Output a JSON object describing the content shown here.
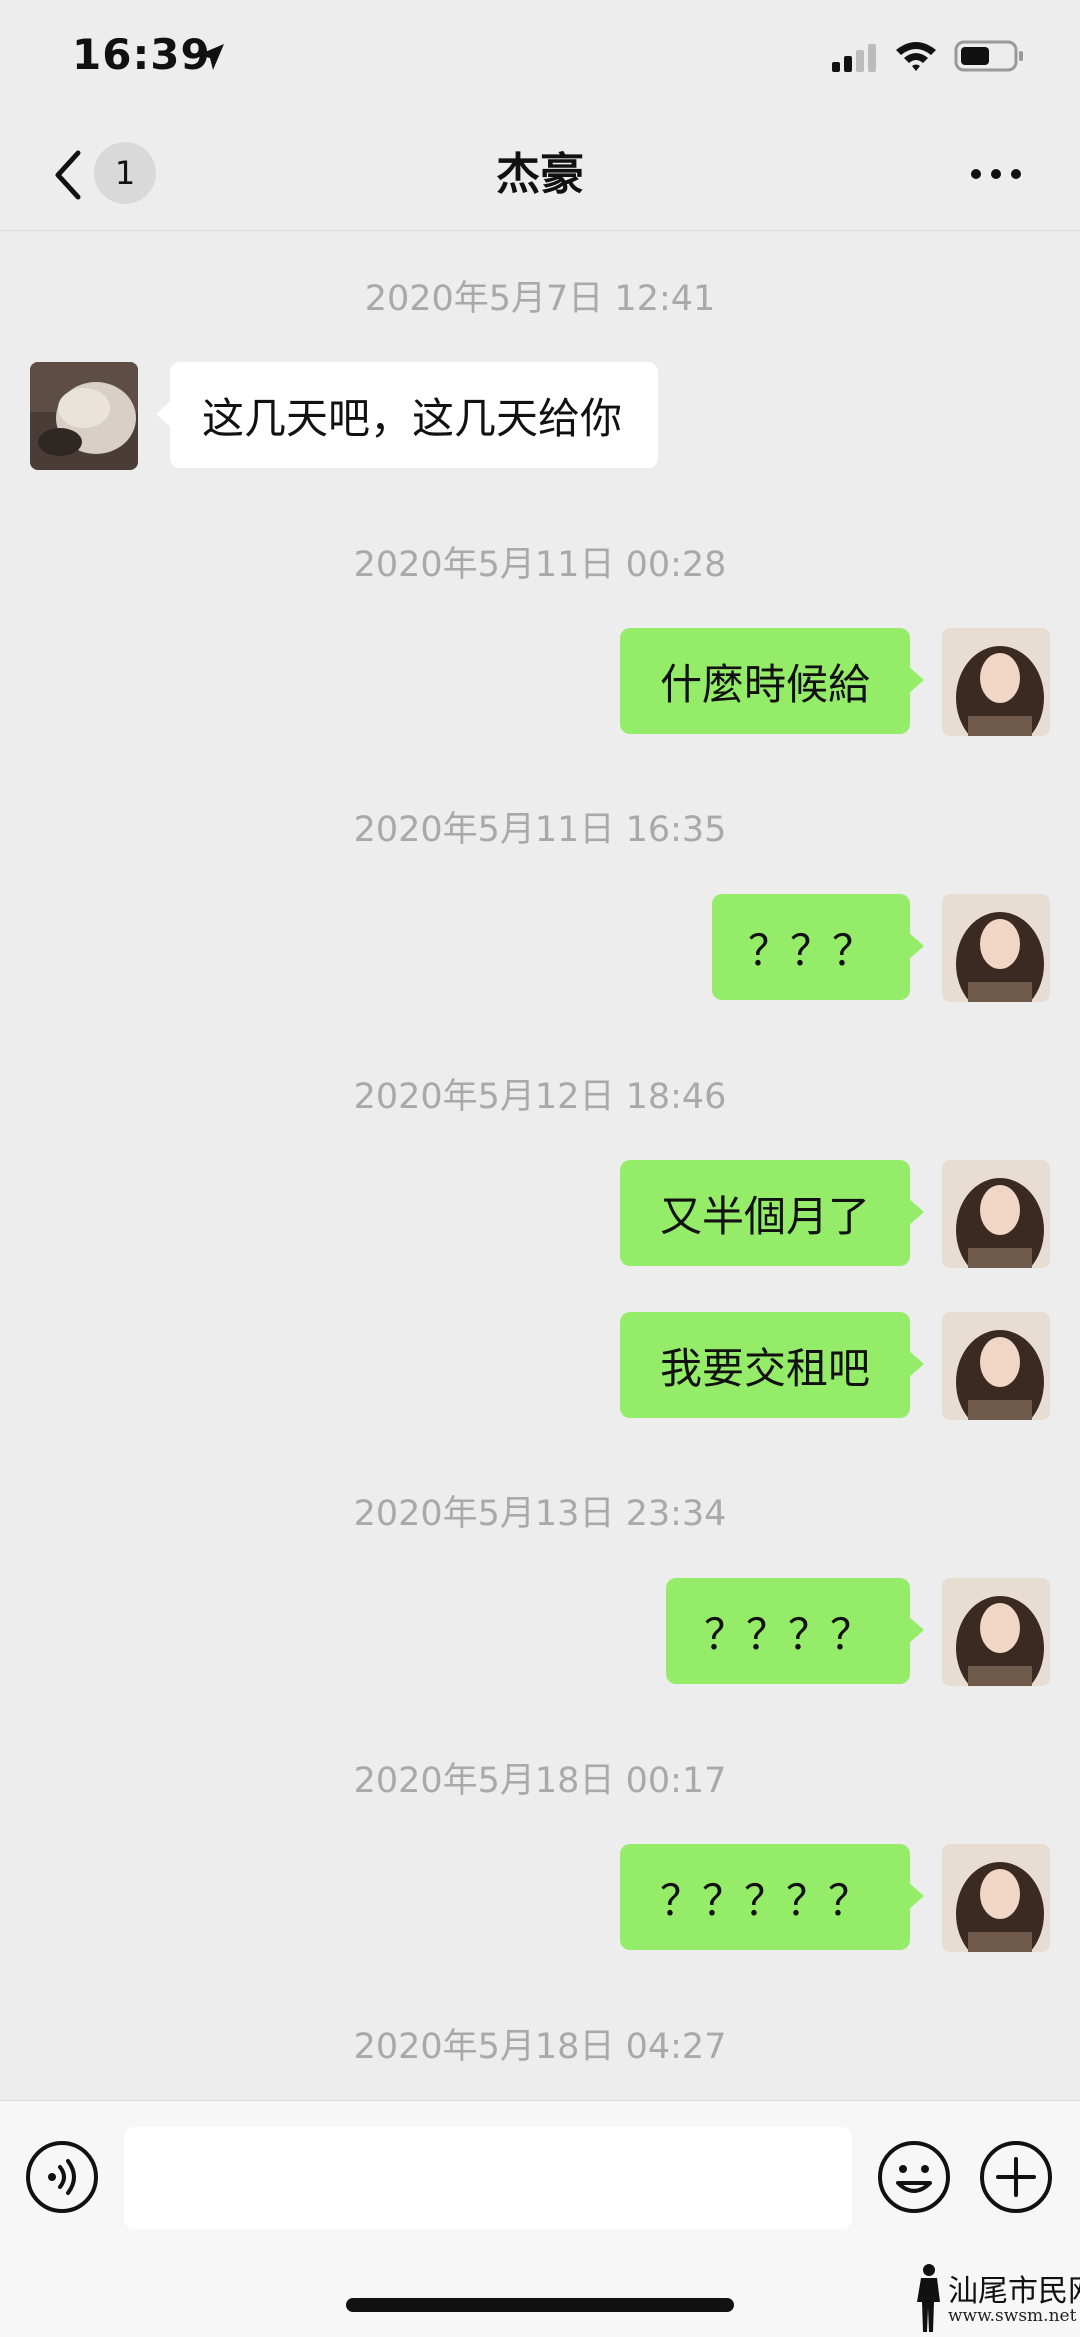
{
  "status_bar": {
    "time": "16:39",
    "icons": [
      "location-arrow-icon",
      "signal-icon",
      "wifi-icon",
      "battery-icon"
    ]
  },
  "nav": {
    "back_icon": "chevron-left-icon",
    "unread_count": "1",
    "title": "杰豪",
    "more_icon": "more-icon"
  },
  "messages": [
    {
      "type": "time",
      "text": "2020年5月7日 12:41"
    },
    {
      "type": "message",
      "direction": "incoming",
      "text": "这几天吧，这几天给你"
    },
    {
      "type": "time",
      "text": "2020年5月11日 00:28"
    },
    {
      "type": "message",
      "direction": "outgoing",
      "text": "什麼時候給"
    },
    {
      "type": "time",
      "text": "2020年5月11日 16:35"
    },
    {
      "type": "message",
      "direction": "outgoing",
      "text": "？？？"
    },
    {
      "type": "time",
      "text": "2020年5月12日 18:46"
    },
    {
      "type": "message",
      "direction": "outgoing",
      "text": "又半個月了"
    },
    {
      "type": "message",
      "direction": "outgoing",
      "text": "我要交租吧"
    },
    {
      "type": "time",
      "text": "2020年5月13日 23:34"
    },
    {
      "type": "message",
      "direction": "outgoing",
      "text": "？？？？"
    },
    {
      "type": "time",
      "text": "2020年5月18日 00:17"
    },
    {
      "type": "message",
      "direction": "outgoing",
      "text": "？？？？？"
    },
    {
      "type": "time",
      "text": "2020年5月18日 04:27"
    }
  ],
  "input_bar": {
    "voice_icon": "voice-icon",
    "input_value": "",
    "emoji_icon": "emoji-icon",
    "plus_icon": "plus-icon"
  },
  "watermark": {
    "text": "汕尾市民网",
    "url": "www.swsm.net"
  },
  "colors": {
    "background": "#ededed",
    "outgoing_bubble": "#95ec69",
    "incoming_bubble": "#ffffff",
    "timestamp": "#a9a9a9"
  }
}
